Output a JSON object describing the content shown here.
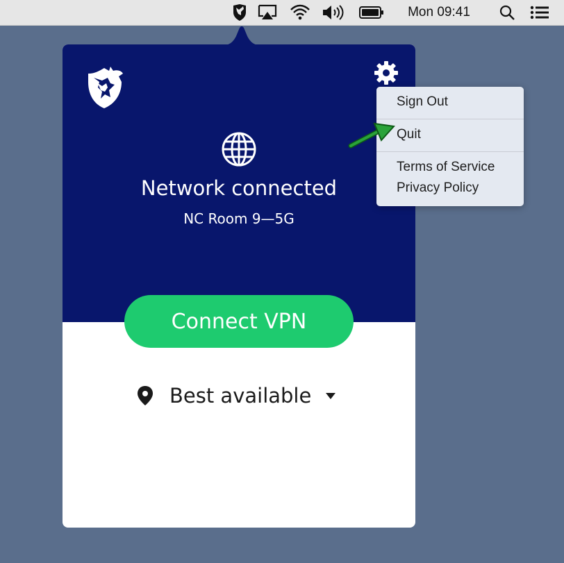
{
  "menubar": {
    "clock": "Mon 09:41",
    "icons": [
      "vpn-shield-icon",
      "airplay-icon",
      "wifi-icon",
      "volume-icon",
      "battery-icon",
      "spotlight-search-icon",
      "notification-list-icon"
    ]
  },
  "app": {
    "status_title": "Network connected",
    "network_name": "NC Room 9—5G",
    "connect_label": "Connect VPN",
    "location_label": "Best available"
  },
  "menu": {
    "sign_out": "Sign Out",
    "quit": "Quit",
    "terms": "Terms of Service",
    "privacy": "Privacy Policy"
  },
  "colors": {
    "header_bg": "#08166c",
    "connect_green": "#1ecb6f",
    "desktop_bg": "#5a6e8c",
    "annotation_arrow": "#1f8a2a"
  }
}
